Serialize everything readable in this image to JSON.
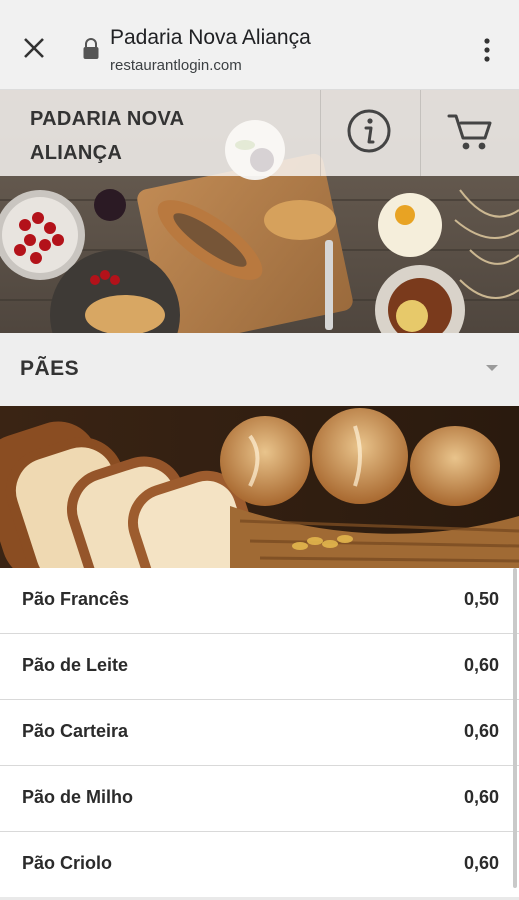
{
  "browser": {
    "title": "Padaria Nova Aliança",
    "url": "restaurantlogin.com",
    "icons": [
      "close-icon",
      "lock-icon",
      "more-vert-icon"
    ]
  },
  "header": {
    "brand_name": "PADARIA NOVA ALIANÇA",
    "icons": [
      "info-icon",
      "cart-icon"
    ]
  },
  "category": {
    "label": "PÃES",
    "icon": "caret-down-icon"
  },
  "items": [
    {
      "name": "Pão Francês",
      "price": "0,50"
    },
    {
      "name": "Pão de Leite",
      "price": "0,60"
    },
    {
      "name": "Pão Carteira",
      "price": "0,60"
    },
    {
      "name": "Pão de Milho",
      "price": "0,60"
    },
    {
      "name": "Pão Criolo",
      "price": "0,60"
    }
  ],
  "colors": {
    "browser_bar": "#f1f1f1",
    "category_bar": "#eeeeee",
    "text": "#2b2b2b"
  }
}
